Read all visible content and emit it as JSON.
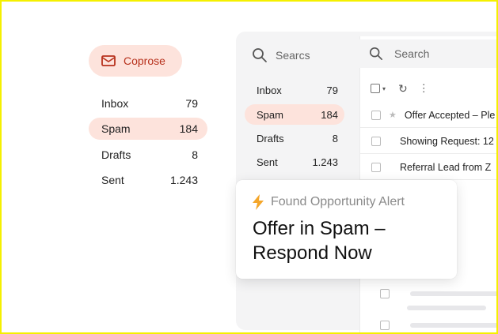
{
  "compose": {
    "label": "Coprose",
    "icon": "mail-icon"
  },
  "left_nav": [
    {
      "label": "Inbox",
      "count": "79",
      "selected": false
    },
    {
      "label": "Spam",
      "count": "184",
      "selected": true
    },
    {
      "label": "Drafts",
      "count": "8",
      "selected": false
    },
    {
      "label": "Sent",
      "count": "1.243",
      "selected": false
    }
  ],
  "middle": {
    "search_text": "Searcs",
    "nav": [
      {
        "label": "Inbox",
        "count": "79",
        "selected": false
      },
      {
        "label": "Spam",
        "count": "184",
        "selected": true
      },
      {
        "label": "Drafts",
        "count": "8",
        "selected": false
      },
      {
        "label": "Sent",
        "count": "1.243",
        "selected": false
      }
    ]
  },
  "right": {
    "search_placeholder": "Search",
    "rows": [
      {
        "subject": "Offer Accepted – Ple"
      },
      {
        "subject": "Showing Request: 12"
      },
      {
        "subject": "Referral Lead from Z"
      }
    ]
  },
  "alert": {
    "heading": "Found Opportunity Alert",
    "title": "Offer in Spam – Respond Now",
    "icon": "lightning-icon"
  },
  "colors": {
    "accent_bg": "#fde3dc",
    "accent_text": "#b7311c",
    "lightning": "#f4a62a",
    "frame_border": "#f5f000"
  }
}
